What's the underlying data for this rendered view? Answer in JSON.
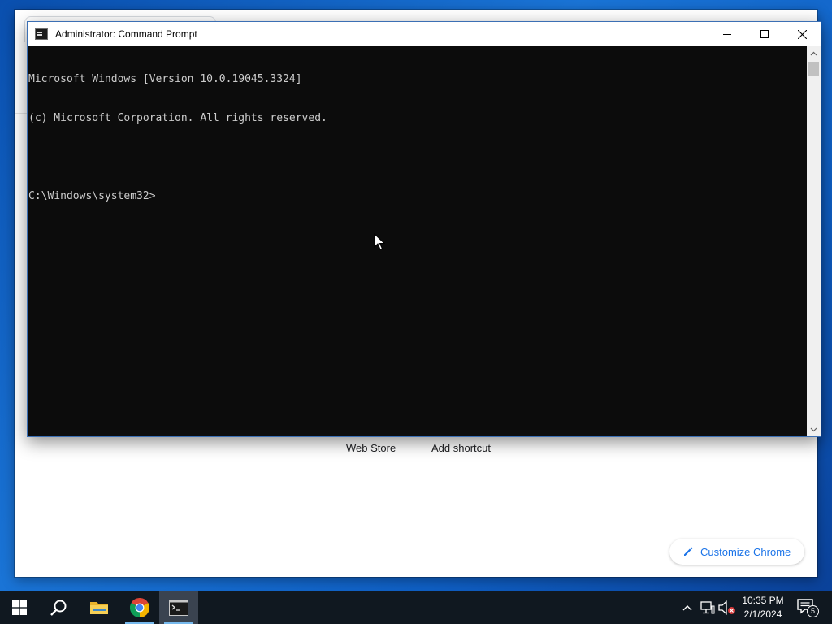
{
  "chrome": {
    "web_store_label": "Web Store",
    "add_shortcut_label": "Add shortcut",
    "customize_label": "Customize Chrome"
  },
  "cmd": {
    "title": "Administrator: Command Prompt",
    "console_lines": [
      "Microsoft Windows [Version 10.0.19045.3324]",
      "(c) Microsoft Corporation. All rights reserved.",
      "",
      "C:\\Windows\\system32>"
    ]
  },
  "taskbar": {
    "time": "10:35 PM",
    "date": "2/1/2024",
    "notification_count": "5",
    "icons": [
      "windows-start-icon",
      "search-icon",
      "file-explorer-icon",
      "chrome-icon",
      "command-prompt-icon"
    ]
  },
  "colors": {
    "console_bg": "#0c0c0c",
    "console_text": "#cccccc",
    "taskbar_bg": "#101820",
    "accent": "#1a73e8"
  }
}
